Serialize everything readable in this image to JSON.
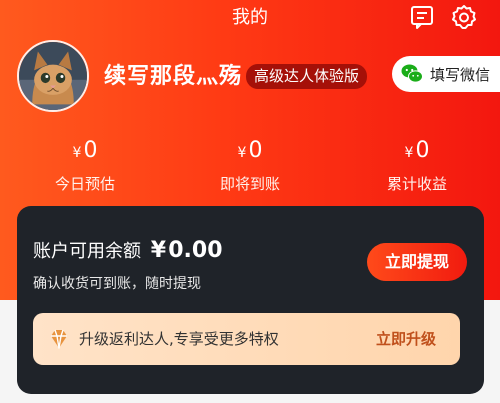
{
  "header": {
    "title": "我的",
    "icons": [
      "message-icon",
      "settings-icon"
    ]
  },
  "profile": {
    "username": "续写那段灬殇",
    "level_badge": "高级达人体验版",
    "wechat_button": "填写微信"
  },
  "stats": [
    {
      "currency": "¥",
      "value": "0",
      "label": "今日预估"
    },
    {
      "currency": "¥",
      "value": "0",
      "label": "即将到账"
    },
    {
      "currency": "¥",
      "value": "0",
      "label": "累计收益"
    }
  ],
  "account": {
    "balance_label": "账户可用余额",
    "currency": "¥",
    "balance": "0.00",
    "subtitle": "确认收货可到账，随时提现",
    "withdraw_button": "立即提现"
  },
  "upgrade": {
    "text": "升级返利达人,专享受更多特权",
    "button": "立即升级"
  },
  "colors": {
    "brand": "#f3170f",
    "card": "#1f2329",
    "upgrade_accent": "#c0501c"
  }
}
